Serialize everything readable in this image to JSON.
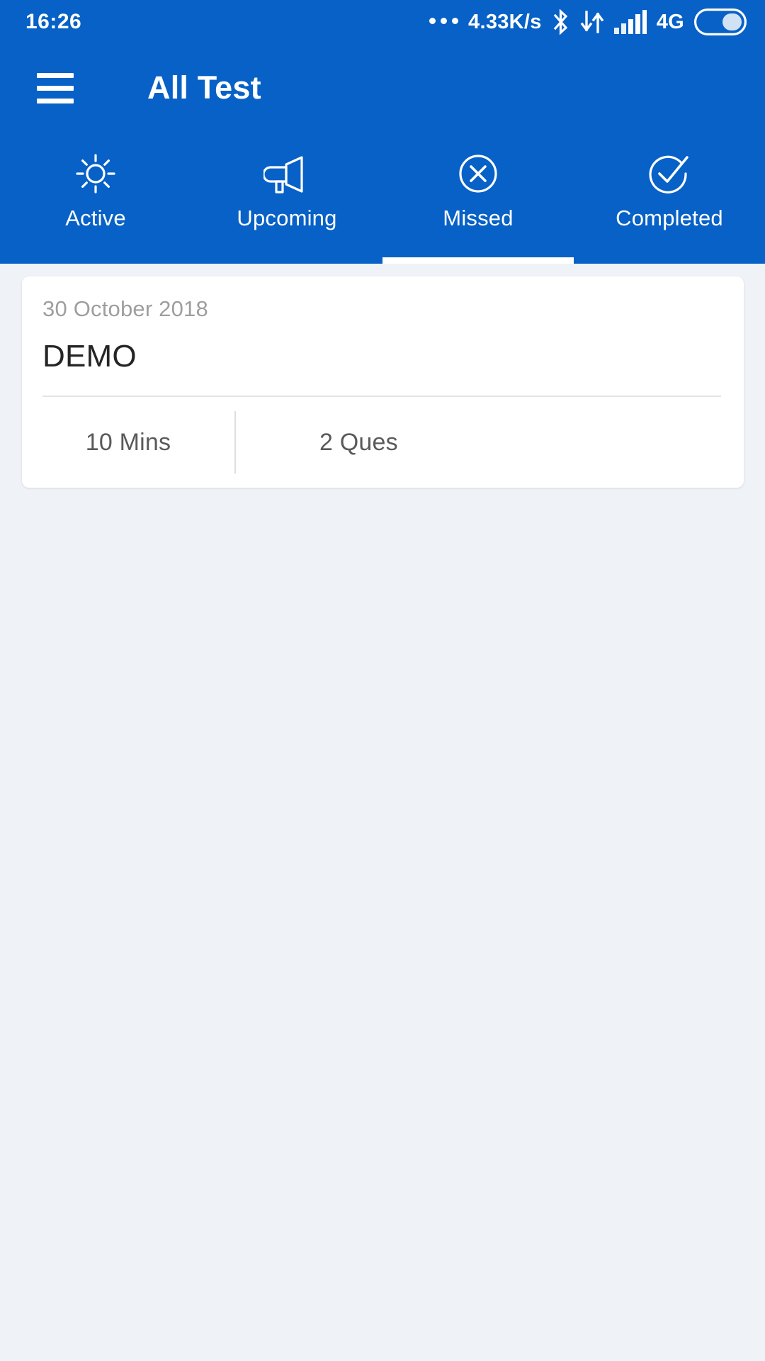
{
  "status_bar": {
    "clock": "16:26",
    "network_speed": "4.33K/s",
    "network_type": "4G",
    "icons": [
      "more-dots-icon",
      "bluetooth-icon",
      "data-transfer-icon",
      "signal-bars-icon",
      "battery-icon"
    ]
  },
  "app_bar": {
    "menu_icon": "hamburger-menu-icon",
    "title": "All Test"
  },
  "tabs": {
    "selected_index": 2,
    "items": [
      {
        "label": "Active",
        "icon": "sun-icon"
      },
      {
        "label": "Upcoming",
        "icon": "megaphone-icon"
      },
      {
        "label": "Missed",
        "icon": "circle-x-icon"
      },
      {
        "label": "Completed",
        "icon": "circle-check-icon"
      }
    ]
  },
  "test_list": [
    {
      "date": "30 October 2018",
      "title": "DEMO",
      "duration": "10 Mins",
      "questions": "2 Ques"
    }
  ],
  "colors": {
    "primary": "#0761c6",
    "page_background": "#eff2f6",
    "card_background": "#ffffff",
    "muted_text": "#9e9e9e",
    "title_text": "#252525",
    "meta_text": "#5a5a5a"
  }
}
